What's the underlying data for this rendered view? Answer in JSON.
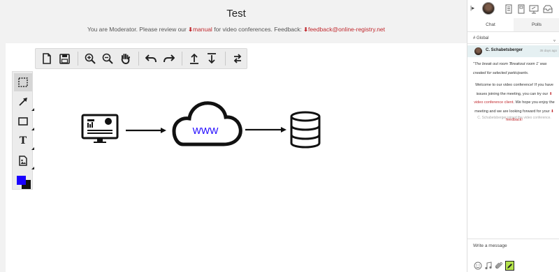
{
  "header": {
    "title": "Test",
    "notice_prefix": "You are Moderator.  Please review our",
    "manual_link": "manual",
    "notice_middle": "for video conferences.  Feedback:",
    "feedback_link": "feedback@online-registry.net"
  },
  "diagram": {
    "cloud_label": "WWW"
  },
  "colors": {
    "primary_color": "#1900ff",
    "secondary_color": "#111111",
    "brand_red": "#c0292e",
    "send_button": "#b4e34c"
  },
  "panel": {
    "tabs": [
      "Chat",
      "Polls"
    ],
    "channel": "# Global",
    "message": {
      "author": "C. Schabetsberger",
      "time": "35 days ago",
      "notice_italic": "\"The break out room 'Breakout room 1' was created for selected participants.",
      "welcome_1": "Welcome to our video conference! If you have issues joining the meeting, you can try our",
      "welcome_link": "video conference client",
      "welcome_2": ". We hope you enjoy the meeting and we are looking forward for your",
      "welcome_feedback": "feedback!",
      "system": "C. Schabetsberger joined the video conference."
    },
    "compose_placeholder": "Write a message"
  }
}
